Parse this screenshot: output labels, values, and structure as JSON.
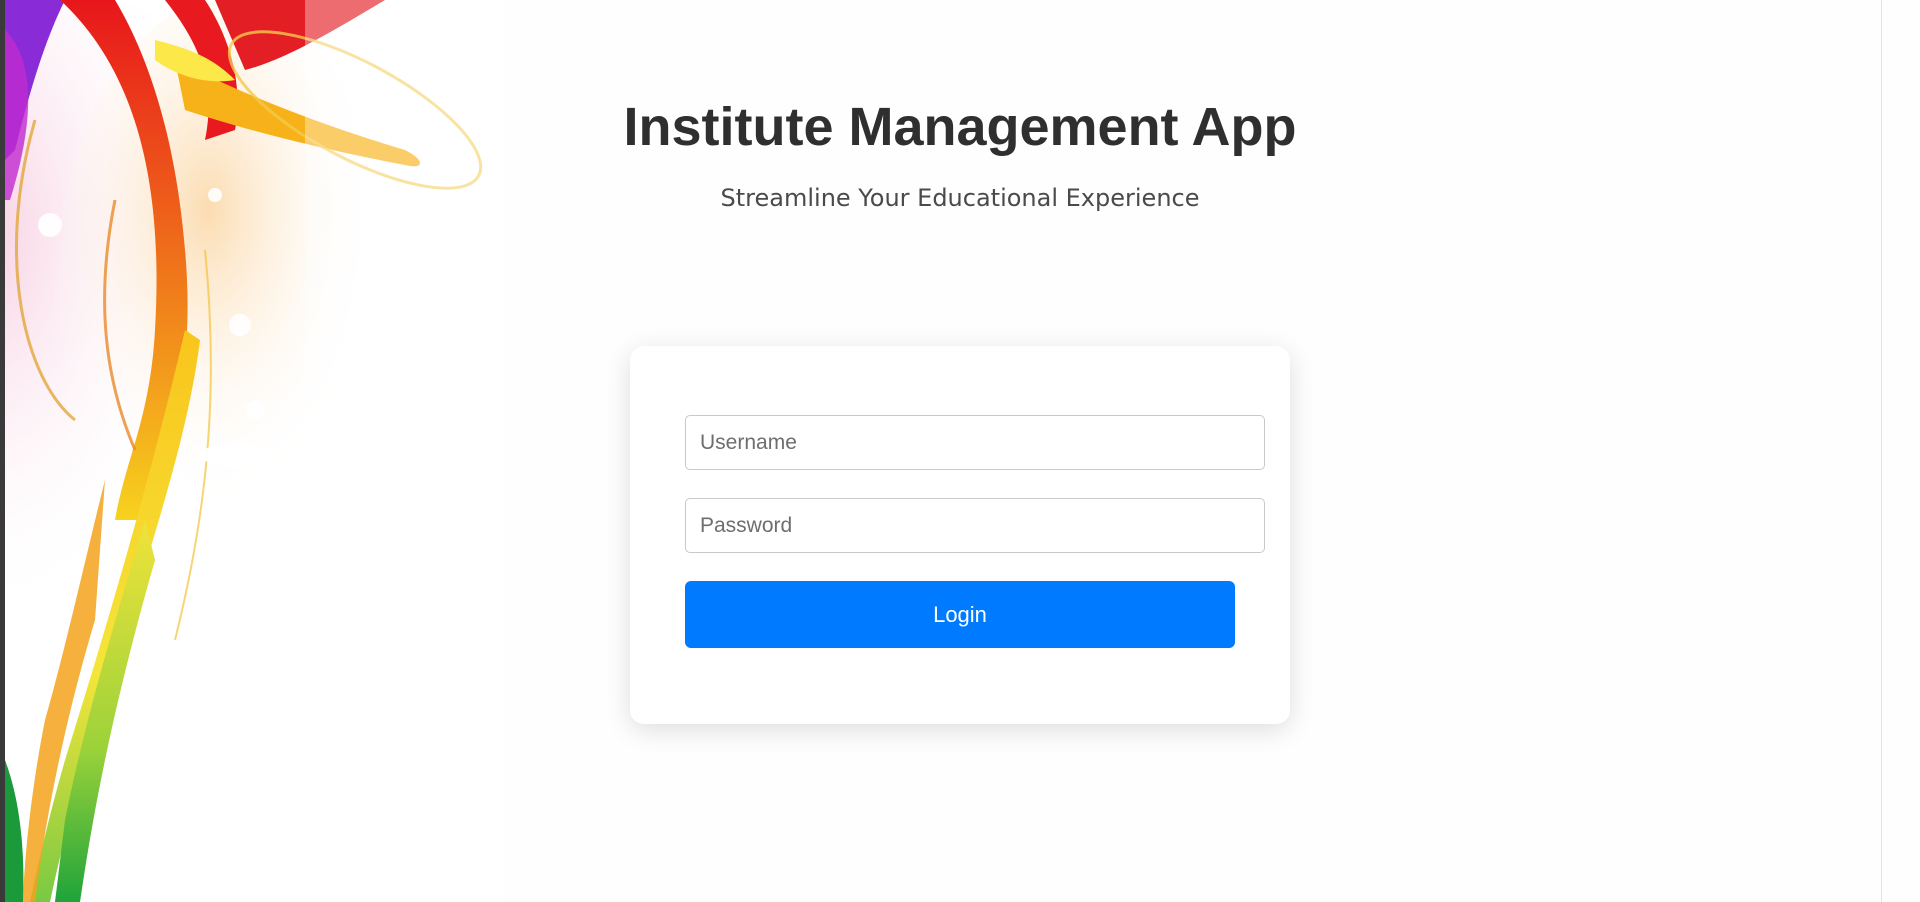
{
  "header": {
    "title": "Institute Management App",
    "subtitle": "Streamline Your Educational Experience"
  },
  "login_form": {
    "username": {
      "value": "",
      "placeholder": "Username"
    },
    "password": {
      "value": "",
      "placeholder": "Password"
    },
    "login_label": "Login"
  },
  "colors": {
    "accent": "#007bff",
    "title_text": "#2f2f2f",
    "subtitle_text": "#4a4a4a",
    "card_background": "#ffffff",
    "page_background": "#fefefe"
  }
}
